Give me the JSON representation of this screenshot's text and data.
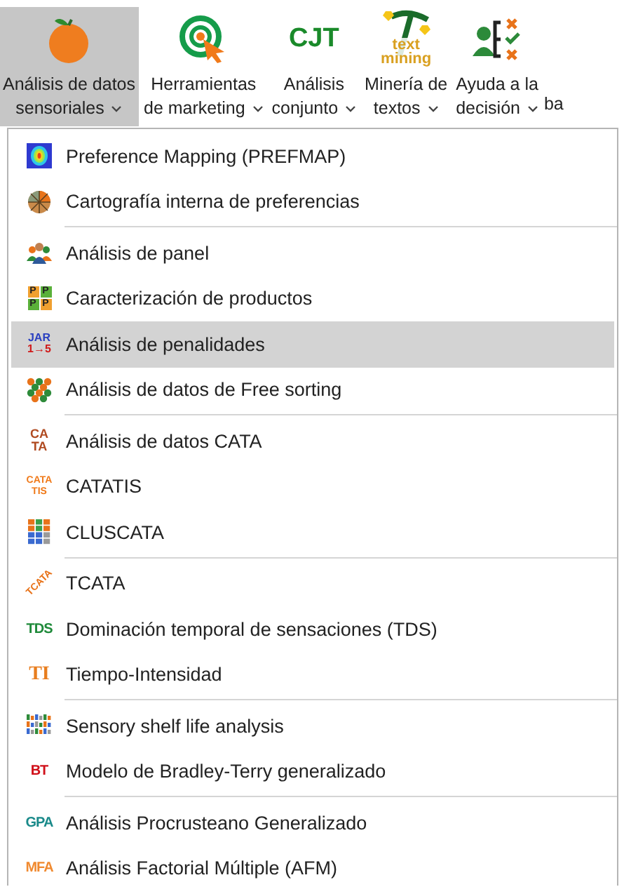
{
  "ribbon": {
    "buttons": [
      {
        "lines": [
          "Análisis de datos",
          "sensoriales"
        ],
        "caret": true,
        "selected": true,
        "kind": "orange"
      },
      {
        "lines": [
          "Herramientas",
          "de marketing"
        ],
        "caret": true,
        "selected": false,
        "kind": "target"
      },
      {
        "lines": [
          "Análisis",
          "conjunto"
        ],
        "caret": true,
        "selected": false,
        "kind": "text",
        "icon_text": [
          "CJT"
        ]
      },
      {
        "lines": [
          "Minería de",
          "textos"
        ],
        "caret": true,
        "selected": false,
        "kind": "mining",
        "icon_text": [
          "text",
          "mining"
        ]
      },
      {
        "lines": [
          "Ayuda a la",
          "decisión"
        ],
        "caret": true,
        "selected": false,
        "kind": "decision"
      },
      {
        "lines": [
          "ba"
        ],
        "caret": false,
        "selected": false,
        "kind": "none"
      }
    ]
  },
  "menu": {
    "groups": [
      {
        "items": [
          {
            "label": "Preference Mapping (PREFMAP)",
            "selected": false,
            "kind": "heatmap"
          },
          {
            "label": "Cartografía interna de preferencias",
            "selected": false,
            "kind": "pie"
          }
        ]
      },
      {
        "items": [
          {
            "label": "Análisis de panel",
            "selected": false,
            "kind": "people"
          },
          {
            "label": "Caracterización de productos",
            "selected": false,
            "kind": "squares",
            "icon_text": [
              "P",
              "P",
              "P",
              "P"
            ]
          },
          {
            "label": "Análisis de penalidades",
            "selected": true,
            "kind": "jar",
            "icon_text": [
              "JAR",
              "1→5"
            ]
          },
          {
            "label": "Análisis de datos de Free sorting",
            "selected": false,
            "kind": "dots"
          }
        ]
      },
      {
        "items": [
          {
            "label": "Análisis de datos CATA",
            "selected": false,
            "kind": "stack",
            "icon_text": [
              "CA",
              "TA"
            ]
          },
          {
            "label": "CATATIS",
            "selected": false,
            "kind": "stack-small",
            "icon_text": [
              "CATA",
              "TIS"
            ]
          },
          {
            "label": "CLUSCATA",
            "selected": false,
            "kind": "grid"
          }
        ]
      },
      {
        "items": [
          {
            "label": "TCATA",
            "selected": false,
            "kind": "diagonal",
            "icon_text": [
              "TCATA"
            ]
          },
          {
            "label": "Dominación temporal de sensaciones (TDS)",
            "selected": false,
            "kind": "word",
            "icon_text": [
              "TDS"
            ],
            "color": "#1f8a3a"
          },
          {
            "label": "Tiempo-Intensidad",
            "selected": false,
            "kind": "serif",
            "icon_text": [
              "TI"
            ],
            "color": "#e87d1e"
          }
        ]
      },
      {
        "items": [
          {
            "label": "Sensory shelf life analysis",
            "selected": false,
            "kind": "bars"
          },
          {
            "label": "Modelo de Bradley-Terry generalizado",
            "selected": false,
            "kind": "word",
            "icon_text": [
              "BT"
            ],
            "color": "#d0101a"
          }
        ]
      },
      {
        "items": [
          {
            "label": "Análisis Procrusteano Generalizado",
            "selected": false,
            "kind": "word",
            "icon_text": [
              "GPA"
            ],
            "color": "#1a8a8a"
          },
          {
            "label": "Análisis Factorial Múltiple (AFM)",
            "selected": false,
            "kind": "word",
            "icon_text": [
              "MFA"
            ],
            "color": "#f08a30"
          }
        ]
      }
    ]
  }
}
